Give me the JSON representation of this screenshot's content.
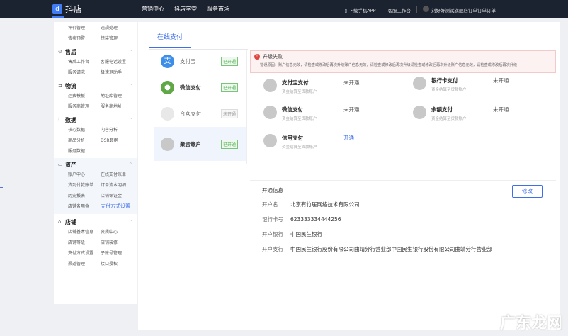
{
  "header": {
    "logo": "抖店",
    "nav": [
      "营销中心",
      "抖店学堂",
      "服务市场"
    ],
    "download": "下载手机APP",
    "service": "客服工作台",
    "user": "刘好好测试旗舰店订单订单订单"
  },
  "sidebar": {
    "top_items": [
      "评价管理",
      "违规处理",
      "售卖预警",
      "榜装管理"
    ],
    "groups": [
      {
        "title": "售后",
        "items": [
          "售后工作台",
          "客服电话设置",
          "服务请求",
          "极速退助手"
        ]
      },
      {
        "title": "物流",
        "items": [
          "运费模板",
          "地址库管理",
          "服务商管理",
          "服务商地址"
        ]
      },
      {
        "title": "数据",
        "items": [
          "核心数据",
          "内容分析",
          "商品分析",
          "DSR数据",
          "服务数据"
        ]
      },
      {
        "title": "资产",
        "items": [
          "账户中心",
          "在线支付账单",
          "货到付款账单",
          "订单流水明细",
          "历史报表",
          "店铺保证金",
          "店铺备用金",
          "支付方式设置"
        ]
      },
      {
        "title": "店铺",
        "items": [
          "店铺基本信息",
          "资质中心",
          "店铺等级",
          "店铺装修",
          "支付方式设置",
          "子账号管理",
          "渠道管理",
          "接口授权"
        ]
      }
    ]
  },
  "main": {
    "tab": "在线支付",
    "methods": [
      {
        "name": "支付宝",
        "status": "已开通"
      },
      {
        "name": "微信支付",
        "status": "已开通"
      },
      {
        "name": "合众支付",
        "status": "未开通"
      },
      {
        "name": "聚合账户",
        "status": "已开通"
      }
    ],
    "alert": {
      "title": "升级失败",
      "detail": "错误原因：账户信息无效，请检查或修改后再次升级账户信息无效，请检查或修改后再次升级请检查或修改后再次升级账户信息无效，请检查或修改后再次升级"
    },
    "channels": [
      {
        "name": "支付宝支付",
        "sub": "资金结算至货款账户",
        "status": "未开通"
      },
      {
        "name": "银行卡支付",
        "sub": "资金结算至货款账户",
        "status": "未开通"
      },
      {
        "name": "微信支付",
        "sub": "资金结算至货款账户",
        "status": "未开通"
      },
      {
        "name": "余额支付",
        "sub": "资金结算至货款账户",
        "status": "未开通"
      },
      {
        "name": "信用支付",
        "sub": "资金结算至货款账户",
        "status": "开通"
      }
    ],
    "info": {
      "title": "开通信息",
      "edit": "修改",
      "rows": [
        {
          "k": "开户名",
          "v": "北京有竹居网络技术有限公司"
        },
        {
          "k": "银行卡号",
          "v": "623333334444256"
        },
        {
          "k": "开户银行",
          "v": "中国民生银行"
        },
        {
          "k": "开户支行",
          "v": "中国民生银行股份有限公司曲靖分行营业部中国民生银行股份有限公司曲靖分行营业部"
        }
      ]
    }
  },
  "watermark": "广东龙网"
}
